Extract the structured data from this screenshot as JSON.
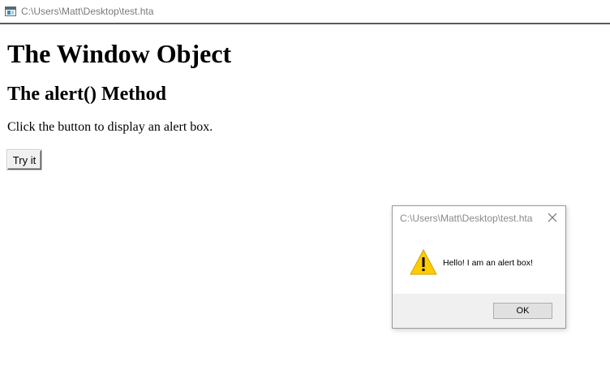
{
  "window": {
    "title": "C:\\Users\\Matt\\Desktop\\test.hta",
    "icon": "hta-window-icon"
  },
  "page": {
    "heading": "The Window Object",
    "subheading": "The alert() Method",
    "paragraph": "Click the button to display an alert box.",
    "button_label": "Try it"
  },
  "alert": {
    "title": "C:\\Users\\Matt\\Desktop\\test.hta",
    "message": "Hello! I am an alert box!",
    "icon": "warning-icon",
    "ok_label": "OK",
    "close_icon": "close-icon"
  },
  "colors": {
    "warning_fill": "#ffcc00",
    "dialog_footer": "#f0f0f0",
    "title_text": "#7a7a7a"
  }
}
